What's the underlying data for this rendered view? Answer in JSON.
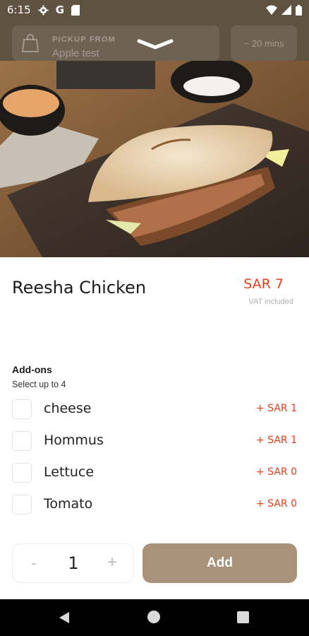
{
  "status_bar": {
    "time": "6:15",
    "g_label": "G"
  },
  "header": {
    "pickup_label": "PICKUP FROM",
    "store_name": "Apple test",
    "eta": "~ 20 mins"
  },
  "product": {
    "name": "Reesha Chicken",
    "price": "SAR 7",
    "vat_note": "VAT included"
  },
  "addons": {
    "title": "Add-ons",
    "subtitle": "Select up to 4",
    "items": [
      {
        "name": "cheese",
        "price": "+  SAR 1"
      },
      {
        "name": "Hommus",
        "price": "+  SAR 1"
      },
      {
        "name": "Lettuce",
        "price": "+  SAR 0"
      },
      {
        "name": "Tomato",
        "price": "+  SAR 0"
      }
    ]
  },
  "cart": {
    "minus_label": "-",
    "quantity": "1",
    "plus_label": "+",
    "add_label": "Add"
  },
  "colors": {
    "accent": "#e8401c",
    "brand": "#a8927a",
    "header": "#5e5240"
  }
}
